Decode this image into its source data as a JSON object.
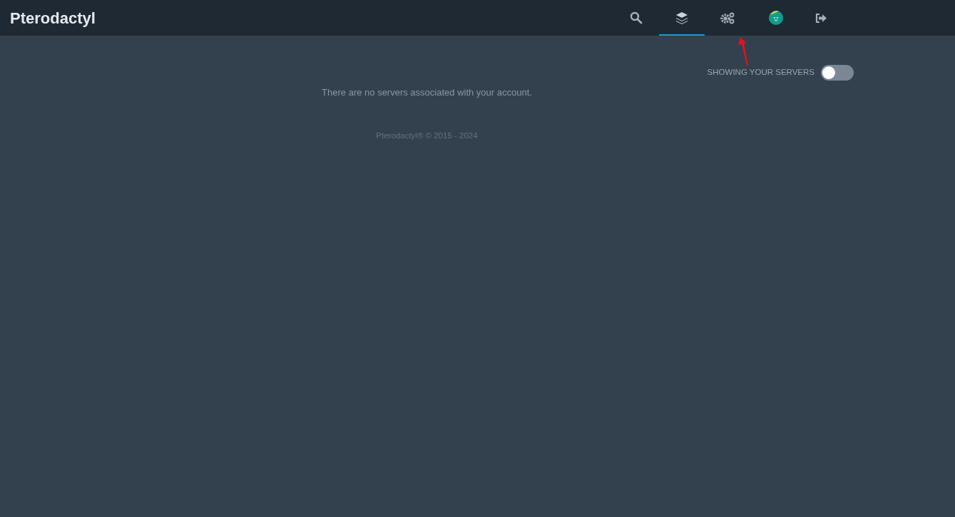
{
  "header": {
    "brand": "Pterodactyl"
  },
  "nav": [
    {
      "kind": "search",
      "selected": false
    },
    {
      "kind": "servers",
      "selected": true
    },
    {
      "kind": "admin",
      "selected": false
    },
    {
      "kind": "avatar",
      "selected": false
    },
    {
      "kind": "logout",
      "selected": false
    }
  ],
  "server_toggle": {
    "label": "SHOWING YOUR SERVERS",
    "on": false
  },
  "message": "There are no servers associated with your account.",
  "footer": "Pterodactyl® © 2015 - 2024"
}
